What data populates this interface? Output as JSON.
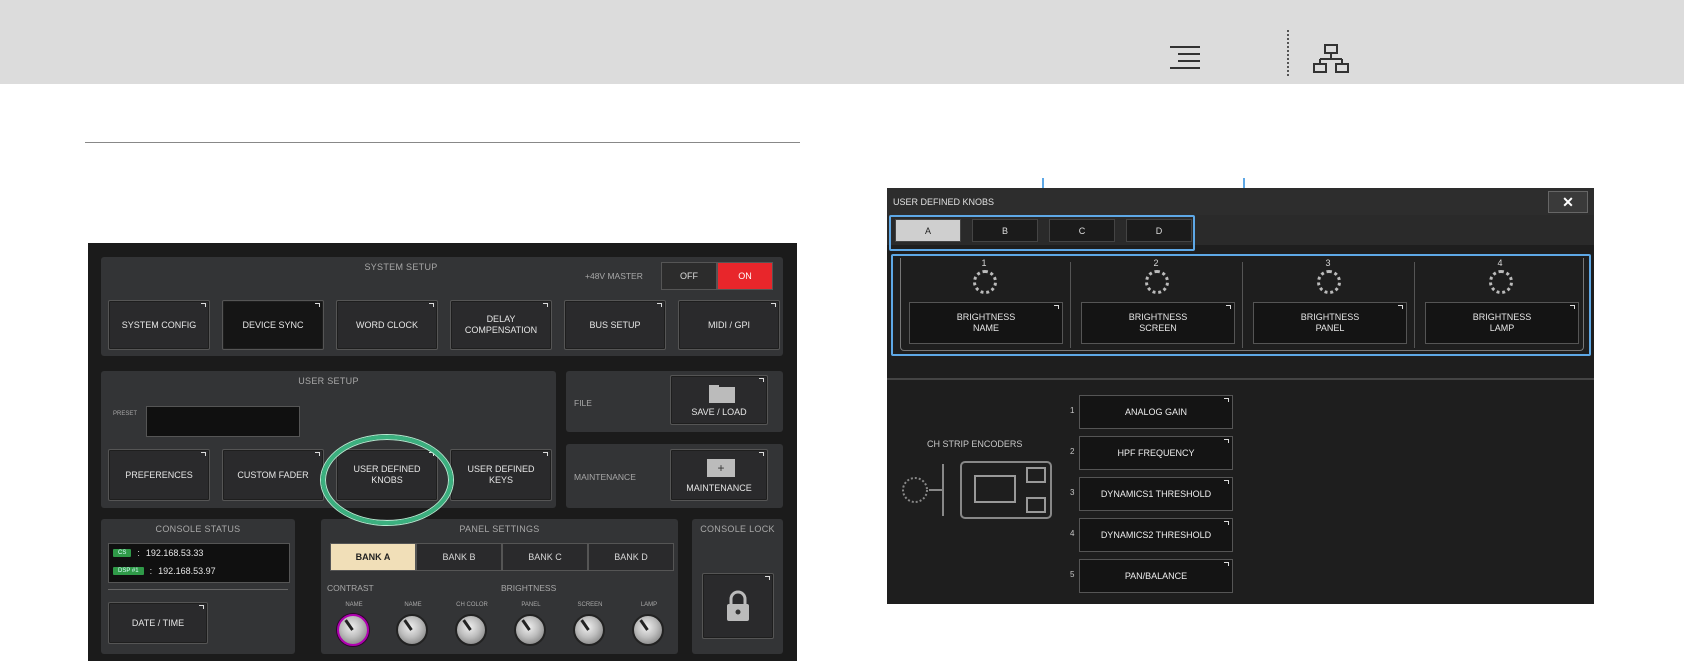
{
  "toolbar": {
    "menu_icon": "menu-lines-icon",
    "sitemap_icon": "sitemap-icon"
  },
  "system_setup": {
    "title": "SYSTEM SETUP",
    "phantom_label": "+48V MASTER",
    "off_label": "OFF",
    "on_label": "ON",
    "buttons": [
      "SYSTEM CONFIG",
      "DEVICE SYNC",
      "WORD CLOCK",
      "DELAY\nCOMPENSATION",
      "BUS SETUP",
      "MIDI / GPI"
    ]
  },
  "user_setup": {
    "title": "USER SETUP",
    "preset_label": "PRESET",
    "buttons": [
      "PREFERENCES",
      "CUSTOM FADER",
      "USER DEFINED\nKNOBS",
      "USER DEFINED\nKEYS"
    ]
  },
  "file": {
    "label": "FILE",
    "button": "SAVE / LOAD"
  },
  "maintenance": {
    "label": "MAINTENANCE",
    "button": "MAINTENANCE"
  },
  "console_status": {
    "title": "CONSOLE STATUS",
    "rows": [
      {
        "chip": "CS",
        "sep": ":",
        "value": "192.168.53.33"
      },
      {
        "chip": "DSP #1",
        "sep": ":",
        "value": "192.168.53.97"
      }
    ],
    "date_button": "DATE / TIME"
  },
  "panel_settings": {
    "title": "PANEL SETTINGS",
    "banks": [
      "BANK A",
      "BANK B",
      "BANK C",
      "BANK D"
    ],
    "contrast_label": "CONTRAST",
    "brightness_label": "BRIGHTNESS",
    "knobs": [
      "NAME",
      "NAME",
      "CH COLOR",
      "PANEL",
      "SCREEN",
      "LAMP"
    ]
  },
  "console_lock": {
    "title": "CONSOLE LOCK",
    "icon": "lock-icon"
  },
  "udk_window": {
    "title": "USER DEFINED KNOBS",
    "close": "✕",
    "tabs": [
      "A",
      "B",
      "C",
      "D"
    ],
    "knobs": [
      {
        "num": "1",
        "label": "BRIGHTNESS\nNAME"
      },
      {
        "num": "2",
        "label": "BRIGHTNESS\nSCREEN"
      },
      {
        "num": "3",
        "label": "BRIGHTNESS\nPANEL"
      },
      {
        "num": "4",
        "label": "BRIGHTNESS\nLAMP"
      }
    ],
    "encoders_title": "CH STRIP ENCODERS",
    "encoders": [
      {
        "num": "1",
        "label": "ANALOG GAIN"
      },
      {
        "num": "2",
        "label": "HPF FREQUENCY"
      },
      {
        "num": "3",
        "label": "DYNAMICS1 THRESHOLD"
      },
      {
        "num": "4",
        "label": "DYNAMICS2 THRESHOLD"
      },
      {
        "num": "5",
        "label": "PAN/BALANCE"
      }
    ]
  }
}
